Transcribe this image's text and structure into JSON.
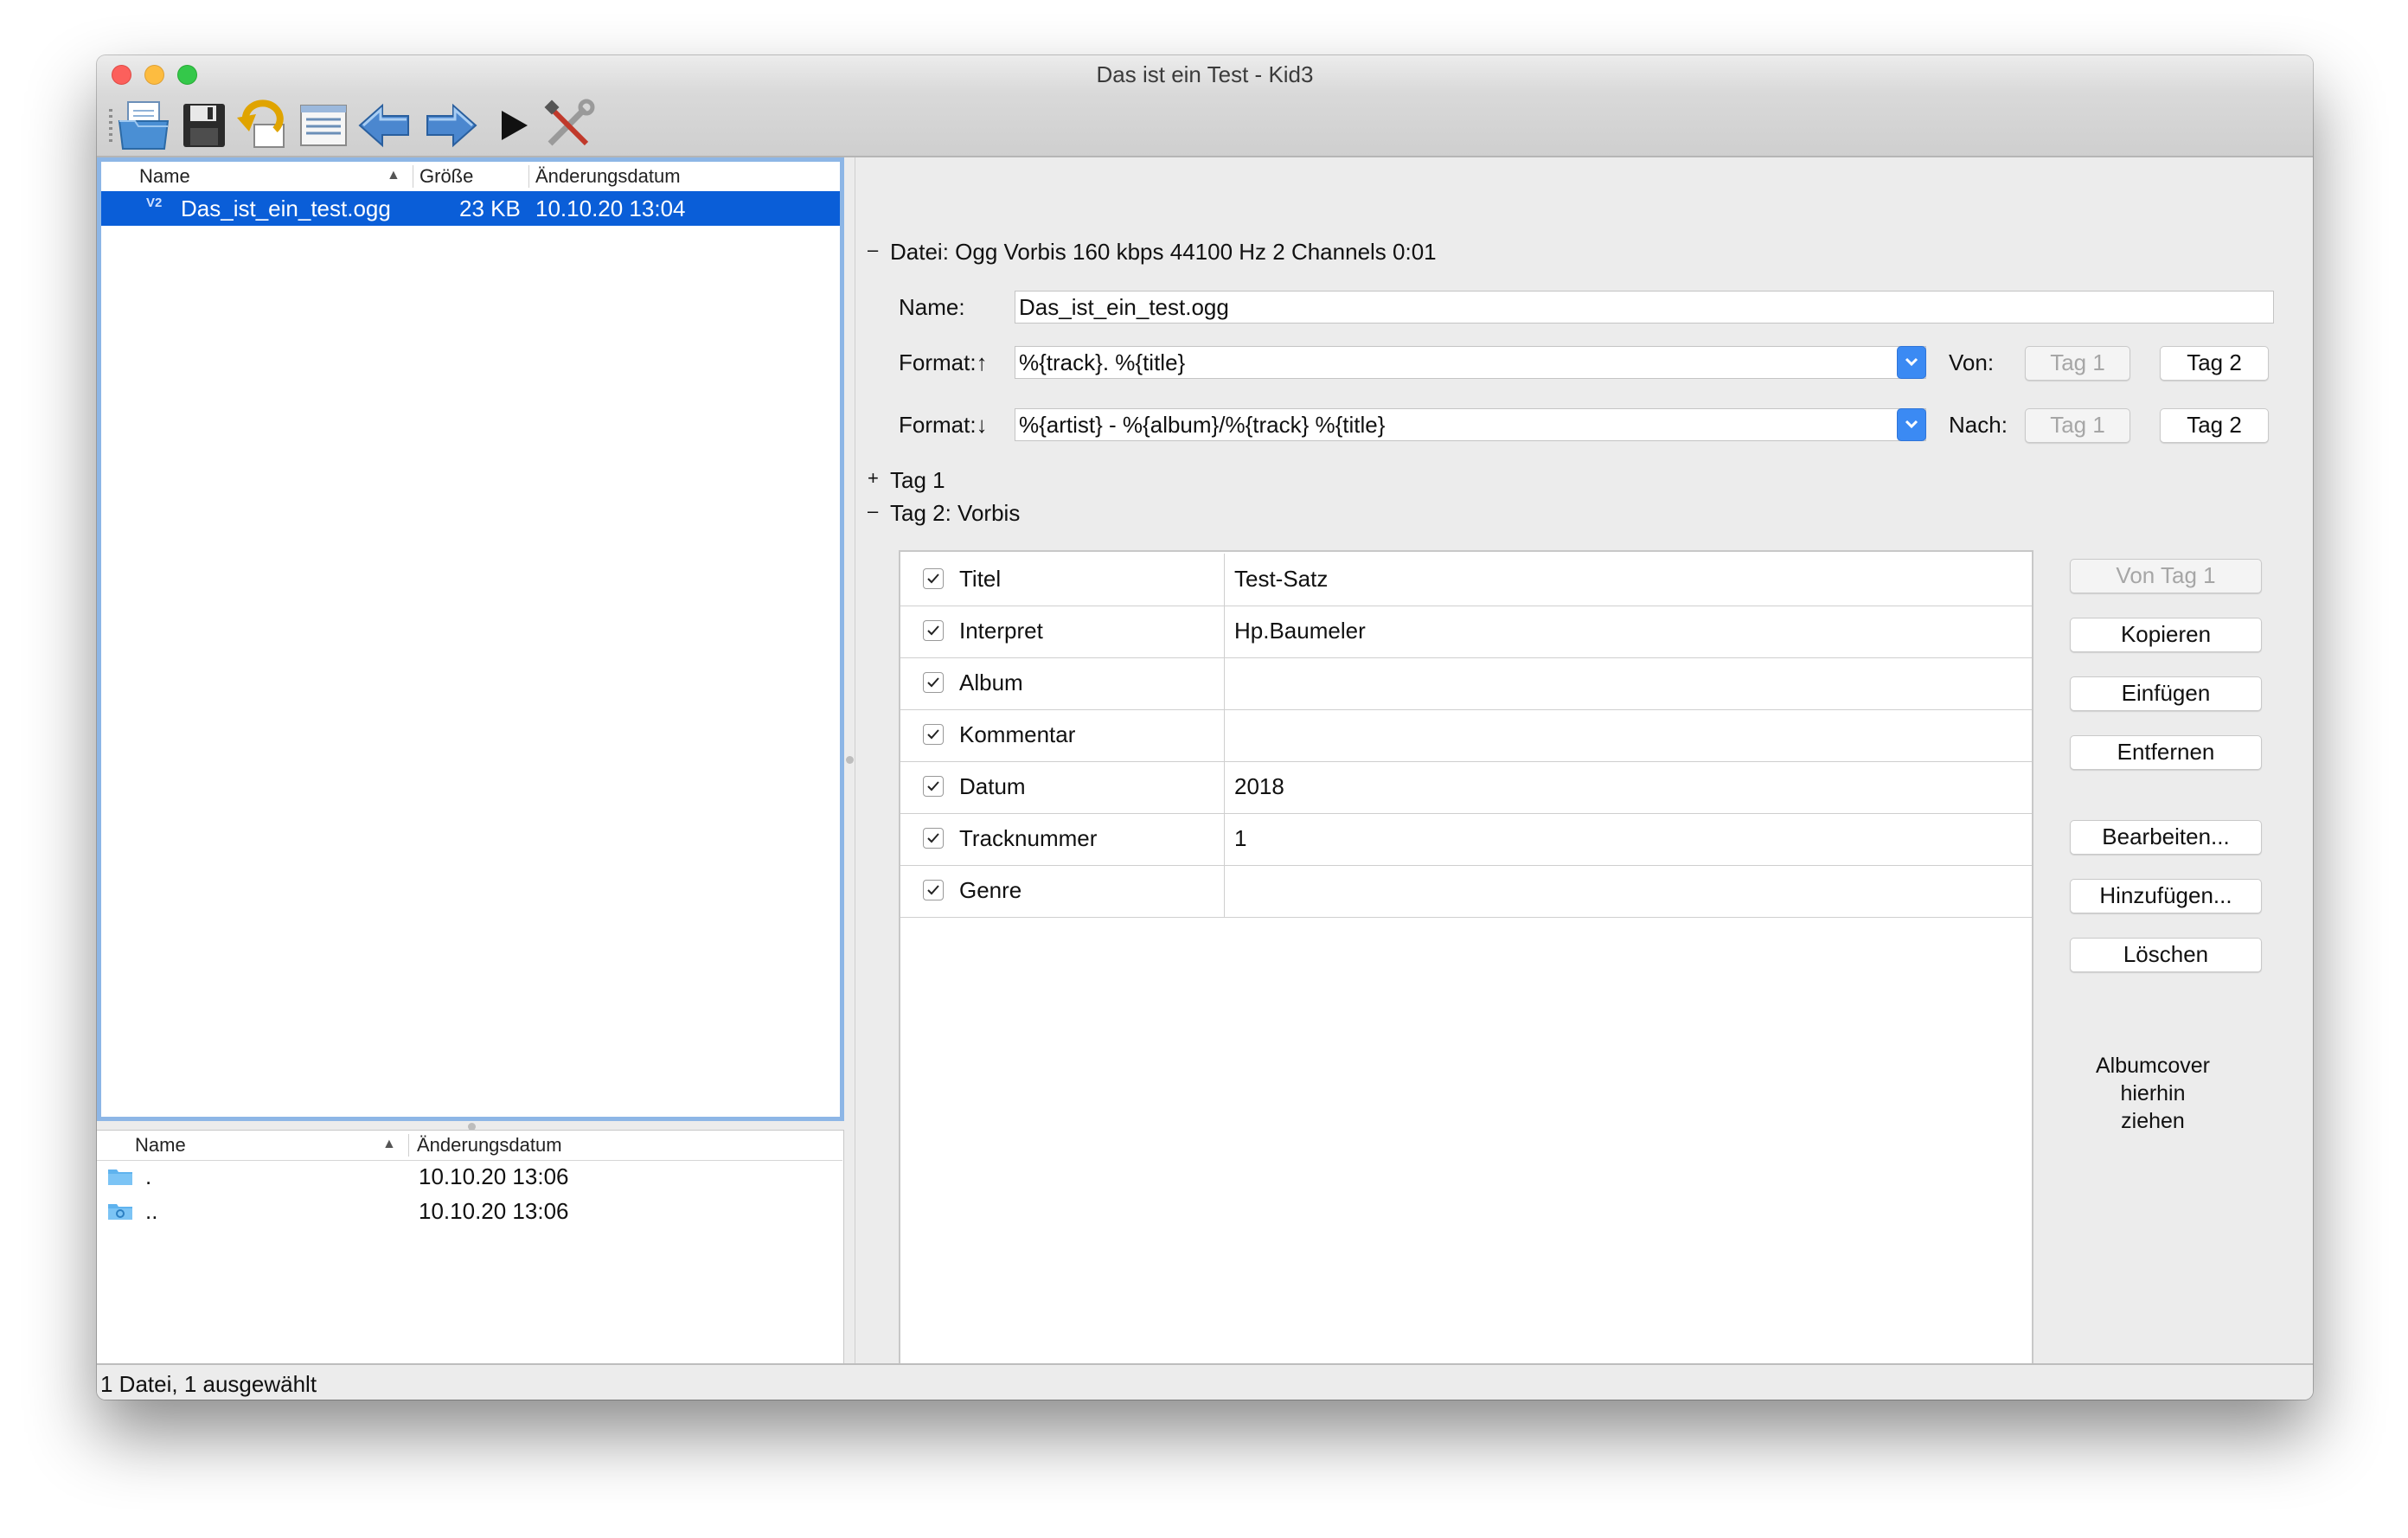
{
  "window": {
    "title": "Das ist ein Test - Kid3"
  },
  "toolbar": {
    "buttons": [
      "open-file-icon",
      "save-icon",
      "revert-icon",
      "file-list-icon",
      "previous-icon",
      "next-icon",
      "play-icon",
      "settings-icon"
    ]
  },
  "filelist": {
    "columns": {
      "name": "Name",
      "size": "Größe",
      "date": "Änderungsdatum"
    },
    "rows": [
      {
        "badge": "V2",
        "name": "Das_ist_ein_test.ogg",
        "size": "23 KB",
        "date": "10.10.20 13:04"
      }
    ]
  },
  "dirlist": {
    "columns": {
      "name": "Name",
      "date": "Änderungsdatum"
    },
    "rows": [
      {
        "name": ".",
        "date": "10.10.20 13:06"
      },
      {
        "name": "..",
        "date": "10.10.20 13:06"
      }
    ]
  },
  "status": {
    "text": "1 Datei, 1 ausgewählt"
  },
  "file_section": {
    "toggle": "–",
    "header": "Datei: Ogg Vorbis 160 kbps 44100 Hz 2 Channels 0:01",
    "name_label": "Name:",
    "name_value": "Das_ist_ein_test.ogg",
    "format_up_label": "Format:↑",
    "format_up_value": "%{track}. %{title}",
    "from_label": "Von:",
    "format_down_label": "Format:↓",
    "format_down_value": "%{artist} - %{album}/%{track} %{title}",
    "to_label": "Nach:",
    "tag1_button": "Tag 1",
    "tag2_button": "Tag 2"
  },
  "tag1_section": {
    "toggle": "+",
    "header": "Tag 1"
  },
  "tag2_section": {
    "toggle": "–",
    "header": "Tag 2: Vorbis",
    "frames": [
      {
        "name": "Titel",
        "value": "Test-Satz"
      },
      {
        "name": "Interpret",
        "value": "Hp.Baumeler"
      },
      {
        "name": "Album",
        "value": ""
      },
      {
        "name": "Kommentar",
        "value": ""
      },
      {
        "name": "Datum",
        "value": "2018"
      },
      {
        "name": "Tracknummer",
        "value": "1"
      },
      {
        "name": "Genre",
        "value": ""
      }
    ]
  },
  "side_buttons": {
    "from_tag1": "Von Tag 1",
    "copy": "Kopieren",
    "paste": "Einfügen",
    "remove": "Entfernen",
    "edit": "Bearbeiten...",
    "add": "Hinzufügen...",
    "delete": "Löschen"
  },
  "albumcover": {
    "line1": "Albumcover",
    "line2": "hierhin",
    "line3": "ziehen"
  },
  "colors": {
    "selection": "#0a5ed8",
    "combo_accent": "#3b8af3",
    "focus_border": "#8db6e6"
  }
}
